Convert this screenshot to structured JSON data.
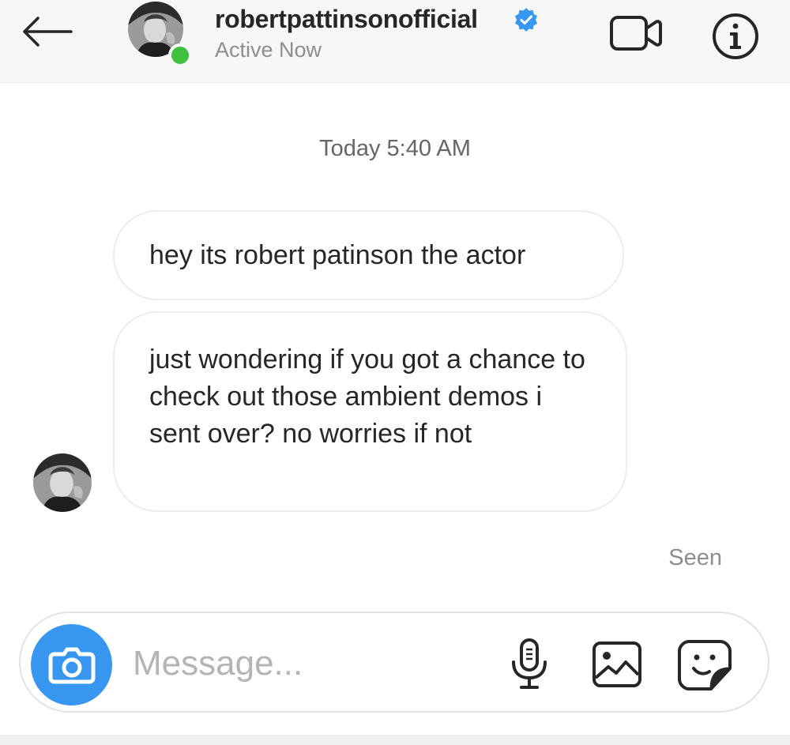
{
  "header": {
    "username": "robertpattinsonofficial",
    "status": "Active Now",
    "verified": true,
    "icons": {
      "back": "back-arrow-icon",
      "video": "video-camera-icon",
      "info": "info-icon",
      "verified": "verified-badge-icon"
    }
  },
  "thread": {
    "timestamp": "Today 5:40 AM",
    "messages": [
      {
        "text": "hey its robert patinson the actor"
      },
      {
        "text": "just wondering if you got a chance to check out those ambient demos i sent over? no worries if not"
      }
    ],
    "seen_label": "Seen"
  },
  "composer": {
    "placeholder": "Message...",
    "icons": {
      "camera": "camera-icon",
      "mic": "microphone-icon",
      "gallery": "image-icon",
      "sticker": "sticker-icon"
    }
  },
  "colors": {
    "header_bg": "#f7f7f7",
    "active_green": "#3ec13e",
    "verified_blue": "#3897f0",
    "camera_blue": "#3797f0",
    "text_primary": "#262626",
    "text_secondary": "#8e8e8e"
  }
}
